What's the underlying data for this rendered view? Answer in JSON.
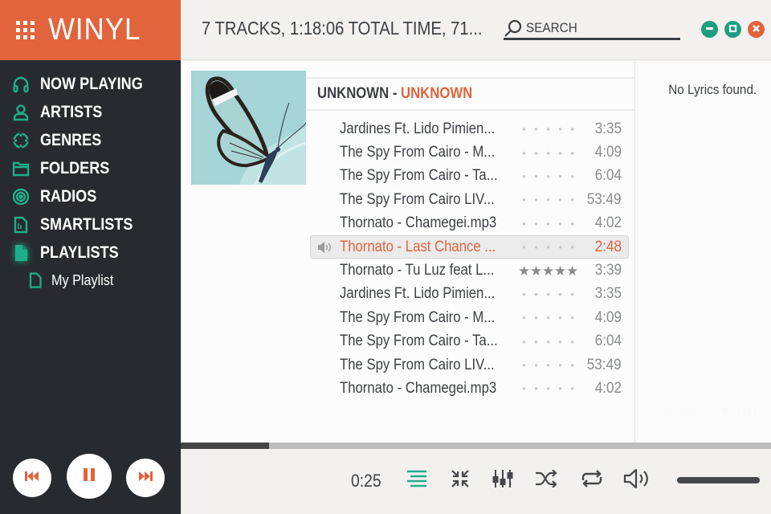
{
  "app": {
    "title": "WINYL",
    "accent_color": "#e2643c",
    "secondary_color": "#1e9e7e"
  },
  "sidebar": {
    "items": [
      {
        "label": "NOW PLAYING",
        "icon": "headphones-icon"
      },
      {
        "label": "ARTISTS",
        "icon": "user-icon"
      },
      {
        "label": "GENRES",
        "icon": "crosshair-icon"
      },
      {
        "label": "FOLDERS",
        "icon": "folder-icon"
      },
      {
        "label": "RADIOS",
        "icon": "radio-icon"
      },
      {
        "label": "SMARTLISTS",
        "icon": "smartlist-icon"
      },
      {
        "label": "PLAYLISTS",
        "icon": "playlist-icon",
        "active": true
      }
    ],
    "sub_items": [
      {
        "label": "My Playlist",
        "icon": "document-icon"
      }
    ],
    "transport": {
      "prev": "previous-icon",
      "play_pause": "pause-icon",
      "next": "next-icon"
    }
  },
  "header": {
    "summary": "7 TRACKS, 1:18:06 TOTAL TIME, 71...",
    "search_placeholder": "SEARCH",
    "search_value": ""
  },
  "album": {
    "artist": "UNKNOWN",
    "separator": " - ",
    "title": "UNKNOWN",
    "cover": "glasswing-butterfly"
  },
  "tracks": [
    {
      "title": "Jardines Ft. Lido Pimien...",
      "rating": 0,
      "duration": "3:35",
      "playing": false
    },
    {
      "title": "The Spy From Cairo - M...",
      "rating": 0,
      "duration": "4:09",
      "playing": false
    },
    {
      "title": "The Spy From Cairo - Ta...",
      "rating": 0,
      "duration": "6:04",
      "playing": false
    },
    {
      "title": "The Spy From Cairo LIV...",
      "rating": 0,
      "duration": "53:49",
      "playing": false
    },
    {
      "title": "Thornato - Chamegei.mp3",
      "rating": 0,
      "duration": "4:02",
      "playing": false
    },
    {
      "title": "Thornato - Last Chance ...",
      "rating": 0,
      "duration": "2:48",
      "playing": true
    },
    {
      "title": "Thornato - Tu Luz feat L...",
      "rating": 5,
      "duration": "3:39",
      "playing": false
    },
    {
      "title": "Jardines Ft. Lido Pimien...",
      "rating": 0,
      "duration": "3:35",
      "playing": false
    },
    {
      "title": "The Spy From Cairo - M...",
      "rating": 0,
      "duration": "4:09",
      "playing": false
    },
    {
      "title": "The Spy From Cairo - Ta...",
      "rating": 0,
      "duration": "6:04",
      "playing": false
    },
    {
      "title": "The Spy From Cairo LIV...",
      "rating": 0,
      "duration": "53:49",
      "playing": false
    },
    {
      "title": "Thornato - Chamegei.mp3",
      "rating": 0,
      "duration": "4:02",
      "playing": false
    }
  ],
  "lyrics": {
    "message": "No Lyrics found."
  },
  "watermark": "codecs.com",
  "player": {
    "current_time": "0:25",
    "progress_percent": 15,
    "volume_percent": 100,
    "controls": [
      "playlist-icon",
      "minimize-view-icon",
      "equalizer-icon",
      "shuffle-icon",
      "repeat-icon",
      "volume-icon"
    ]
  }
}
